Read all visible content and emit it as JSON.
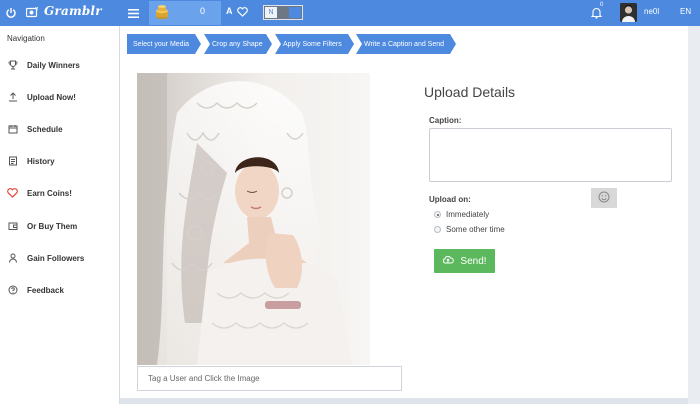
{
  "app": {
    "brand": "Gramblr"
  },
  "topbar": {
    "coins": "0",
    "a_letter": "A",
    "toggle_label": "N",
    "notifications": "0",
    "username": "ne0l",
    "language": "EN"
  },
  "sidebar": {
    "title": "Navigation",
    "items": [
      {
        "label": "Daily Winners",
        "icon": "trophy-icon"
      },
      {
        "label": "Upload Now!",
        "icon": "upload-icon"
      },
      {
        "label": "Schedule",
        "icon": "calendar-icon"
      },
      {
        "label": "History",
        "icon": "history-icon"
      },
      {
        "label": "Earn Coins!",
        "icon": "heart-icon"
      },
      {
        "label": "Or Buy Them",
        "icon": "wallet-icon"
      },
      {
        "label": "Gain Followers",
        "icon": "user-icon"
      },
      {
        "label": "Feedback",
        "icon": "help-icon"
      }
    ]
  },
  "steps": [
    "Select your Media",
    "Crop any Shape",
    "Apply Some Filters",
    "Write a Caption and Send"
  ],
  "tag": {
    "placeholder": "Tag a User and Click the Image"
  },
  "details": {
    "title": "Upload Details",
    "caption_label": "Caption:",
    "caption_value": "",
    "upload_on_label": "Upload on:",
    "option_now": "Immediately",
    "option_later": "Some other time",
    "selected": "Immediately",
    "send_label": "Send!"
  },
  "colors": {
    "accent": "#4d89df",
    "send": "#5cb85c",
    "heart": "#e0453a"
  }
}
